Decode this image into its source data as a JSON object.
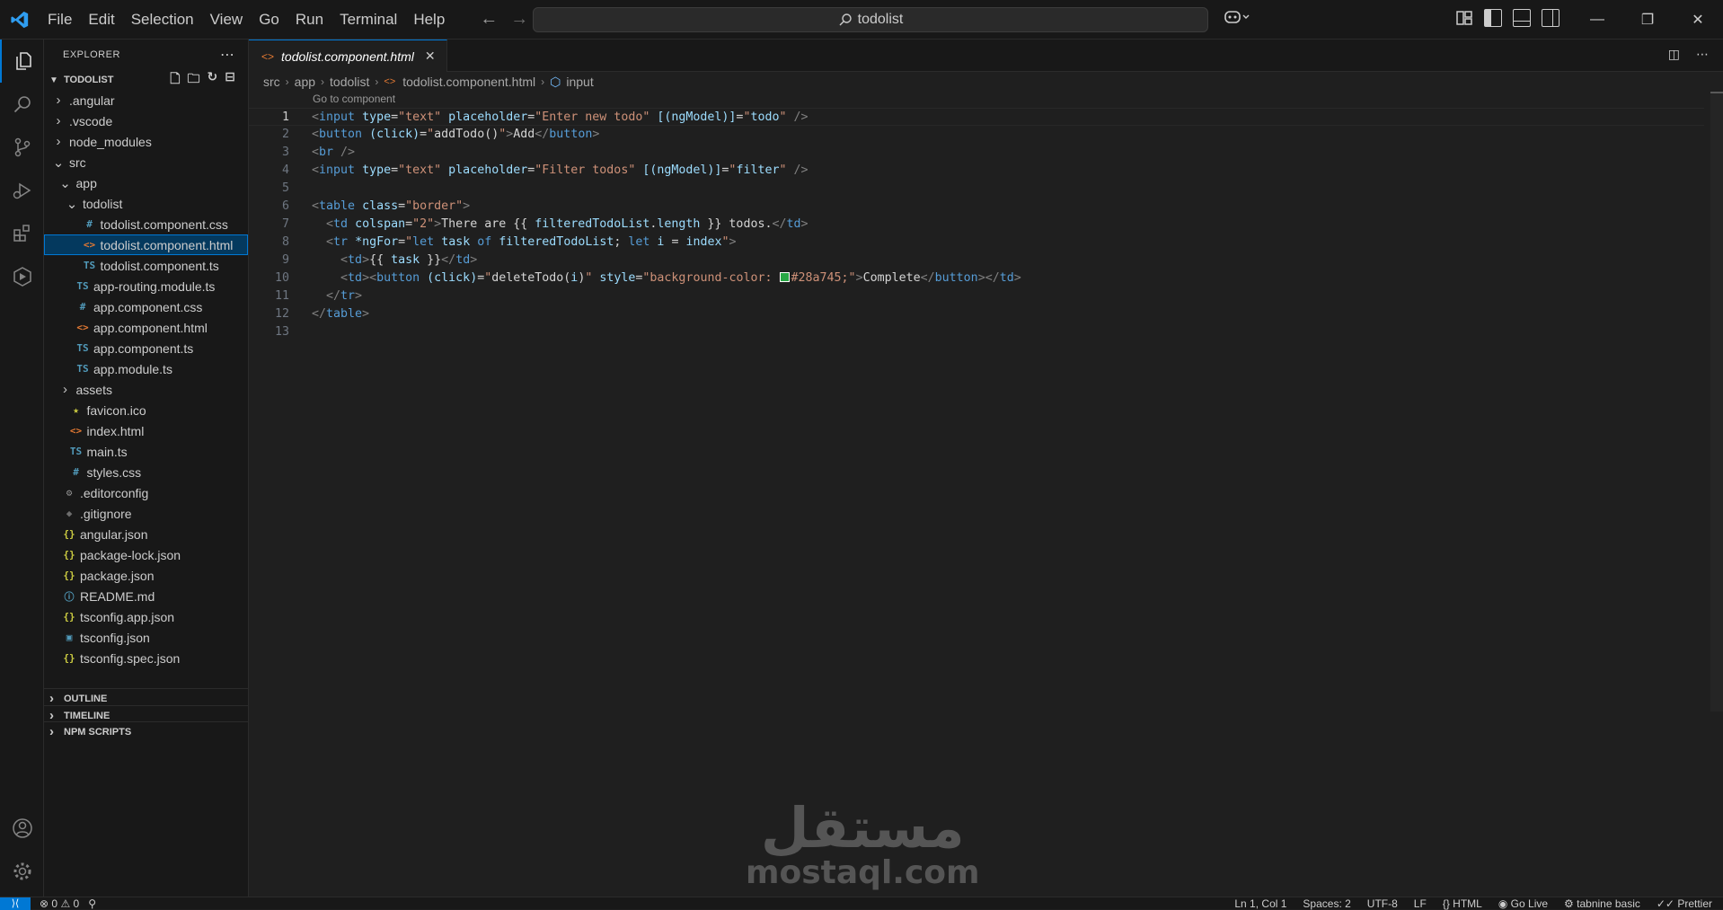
{
  "app": {
    "menu": [
      "File",
      "Edit",
      "Selection",
      "View",
      "Go",
      "Run",
      "Terminal",
      "Help"
    ],
    "search_text": "todolist"
  },
  "explorer": {
    "title": "EXPLORER",
    "root": "TODOLIST",
    "tree": [
      {
        "label": ".angular",
        "depth": 1,
        "kind": "folder",
        "expanded": false
      },
      {
        "label": ".vscode",
        "depth": 1,
        "kind": "folder",
        "expanded": false
      },
      {
        "label": "node_modules",
        "depth": 1,
        "kind": "folder",
        "expanded": false
      },
      {
        "label": "src",
        "depth": 1,
        "kind": "folder",
        "expanded": true
      },
      {
        "label": "app",
        "depth": 2,
        "kind": "folder",
        "expanded": true
      },
      {
        "label": "todolist",
        "depth": 3,
        "kind": "folder",
        "expanded": true
      },
      {
        "label": "todolist.component.css",
        "depth": 4,
        "kind": "css"
      },
      {
        "label": "todolist.component.html",
        "depth": 4,
        "kind": "html",
        "selected": true
      },
      {
        "label": "todolist.component.ts",
        "depth": 4,
        "kind": "ts"
      },
      {
        "label": "app-routing.module.ts",
        "depth": 3,
        "kind": "ts"
      },
      {
        "label": "app.component.css",
        "depth": 3,
        "kind": "css"
      },
      {
        "label": "app.component.html",
        "depth": 3,
        "kind": "html"
      },
      {
        "label": "app.component.ts",
        "depth": 3,
        "kind": "ts"
      },
      {
        "label": "app.module.ts",
        "depth": 3,
        "kind": "ts"
      },
      {
        "label": "assets",
        "depth": 2,
        "kind": "folder",
        "expanded": false
      },
      {
        "label": "favicon.ico",
        "depth": 2,
        "kind": "ico"
      },
      {
        "label": "index.html",
        "depth": 2,
        "kind": "html"
      },
      {
        "label": "main.ts",
        "depth": 2,
        "kind": "ts"
      },
      {
        "label": "styles.css",
        "depth": 2,
        "kind": "css"
      },
      {
        "label": ".editorconfig",
        "depth": 1,
        "kind": "config"
      },
      {
        "label": ".gitignore",
        "depth": 1,
        "kind": "git"
      },
      {
        "label": "angular.json",
        "depth": 1,
        "kind": "json"
      },
      {
        "label": "package-lock.json",
        "depth": 1,
        "kind": "json"
      },
      {
        "label": "package.json",
        "depth": 1,
        "kind": "json"
      },
      {
        "label": "README.md",
        "depth": 1,
        "kind": "md"
      },
      {
        "label": "tsconfig.app.json",
        "depth": 1,
        "kind": "json"
      },
      {
        "label": "tsconfig.json",
        "depth": 1,
        "kind": "tsconfig"
      },
      {
        "label": "tsconfig.spec.json",
        "depth": 1,
        "kind": "json"
      }
    ],
    "sections": [
      "OUTLINE",
      "TIMELINE",
      "NPM SCRIPTS"
    ]
  },
  "editor": {
    "tab_label": "todolist.component.html",
    "breadcrumb": [
      "src",
      "app",
      "todolist",
      "todolist.component.html",
      "input"
    ],
    "codelens": "Go to component",
    "lines": [
      [
        [
          "t-tag",
          "<"
        ],
        [
          "t-name",
          "input"
        ],
        [
          "t-txt",
          " "
        ],
        [
          "t-attr",
          "type"
        ],
        [
          "t-txt",
          "="
        ],
        [
          "t-str",
          "\"text\""
        ],
        [
          "t-txt",
          " "
        ],
        [
          "t-attr",
          "placeholder"
        ],
        [
          "t-txt",
          "="
        ],
        [
          "t-str",
          "\"Enter new todo\""
        ],
        [
          "t-txt",
          " "
        ],
        [
          "t-attr",
          "[(ngModel)]"
        ],
        [
          "t-txt",
          "="
        ],
        [
          "t-str",
          "\""
        ],
        [
          "t-var",
          "todo"
        ],
        [
          "t-str",
          "\""
        ],
        [
          "t-txt",
          " "
        ],
        [
          "t-tag",
          "/>"
        ]
      ],
      [
        [
          "t-tag",
          "<"
        ],
        [
          "t-name",
          "button"
        ],
        [
          "t-txt",
          " "
        ],
        [
          "t-attr",
          "(click)"
        ],
        [
          "t-txt",
          "="
        ],
        [
          "t-str",
          "\""
        ],
        [
          "t-txt",
          "addTodo()"
        ],
        [
          "t-str",
          "\""
        ],
        [
          "t-tag",
          ">"
        ],
        [
          "t-txt",
          "Add"
        ],
        [
          "t-tag",
          "</"
        ],
        [
          "t-name",
          "button"
        ],
        [
          "t-tag",
          ">"
        ]
      ],
      [
        [
          "t-tag",
          "<"
        ],
        [
          "t-name",
          "br"
        ],
        [
          "t-txt",
          " "
        ],
        [
          "t-tag",
          "/>"
        ]
      ],
      [
        [
          "t-tag",
          "<"
        ],
        [
          "t-name",
          "input"
        ],
        [
          "t-txt",
          " "
        ],
        [
          "t-attr",
          "type"
        ],
        [
          "t-txt",
          "="
        ],
        [
          "t-str",
          "\"text\""
        ],
        [
          "t-txt",
          " "
        ],
        [
          "t-attr",
          "placeholder"
        ],
        [
          "t-txt",
          "="
        ],
        [
          "t-str",
          "\"Filter todos\""
        ],
        [
          "t-txt",
          " "
        ],
        [
          "t-attr",
          "[(ngModel)]"
        ],
        [
          "t-txt",
          "="
        ],
        [
          "t-str",
          "\""
        ],
        [
          "t-var",
          "filter"
        ],
        [
          "t-str",
          "\""
        ],
        [
          "t-txt",
          " "
        ],
        [
          "t-tag",
          "/>"
        ]
      ],
      [],
      [
        [
          "t-tag",
          "<"
        ],
        [
          "t-name",
          "table"
        ],
        [
          "t-txt",
          " "
        ],
        [
          "t-attr",
          "class"
        ],
        [
          "t-txt",
          "="
        ],
        [
          "t-str",
          "\"border\""
        ],
        [
          "t-tag",
          ">"
        ]
      ],
      [
        [
          "t-txt",
          "  "
        ],
        [
          "t-tag",
          "<"
        ],
        [
          "t-name",
          "td"
        ],
        [
          "t-txt",
          " "
        ],
        [
          "t-attr",
          "colspan"
        ],
        [
          "t-txt",
          "="
        ],
        [
          "t-str",
          "\"2\""
        ],
        [
          "t-tag",
          ">"
        ],
        [
          "t-txt",
          "There are {{ "
        ],
        [
          "t-var",
          "filteredTodoList"
        ],
        [
          "t-txt",
          "."
        ],
        [
          "t-var",
          "length"
        ],
        [
          "t-txt",
          " }} todos."
        ],
        [
          "t-tag",
          "</"
        ],
        [
          "t-name",
          "td"
        ],
        [
          "t-tag",
          ">"
        ]
      ],
      [
        [
          "t-txt",
          "  "
        ],
        [
          "t-tag",
          "<"
        ],
        [
          "t-name",
          "tr"
        ],
        [
          "t-txt",
          " "
        ],
        [
          "t-attr",
          "*ngFor"
        ],
        [
          "t-txt",
          "="
        ],
        [
          "t-str",
          "\""
        ],
        [
          "t-kw",
          "let"
        ],
        [
          "t-txt",
          " "
        ],
        [
          "t-var",
          "task"
        ],
        [
          "t-txt",
          " "
        ],
        [
          "t-kw",
          "of"
        ],
        [
          "t-txt",
          " "
        ],
        [
          "t-var",
          "filteredTodoList"
        ],
        [
          "t-txt",
          "; "
        ],
        [
          "t-kw",
          "let"
        ],
        [
          "t-txt",
          " "
        ],
        [
          "t-var",
          "i"
        ],
        [
          "t-txt",
          " = "
        ],
        [
          "t-var",
          "index"
        ],
        [
          "t-str",
          "\""
        ],
        [
          "t-tag",
          ">"
        ]
      ],
      [
        [
          "t-txt",
          "    "
        ],
        [
          "t-tag",
          "<"
        ],
        [
          "t-name",
          "td"
        ],
        [
          "t-tag",
          ">"
        ],
        [
          "t-txt",
          "{{ "
        ],
        [
          "t-var",
          "task"
        ],
        [
          "t-txt",
          " }}"
        ],
        [
          "t-tag",
          "</"
        ],
        [
          "t-name",
          "td"
        ],
        [
          "t-tag",
          ">"
        ]
      ],
      [
        [
          "t-txt",
          "    "
        ],
        [
          "t-tag",
          "<"
        ],
        [
          "t-name",
          "td"
        ],
        [
          "t-tag",
          ">"
        ],
        [
          "t-tag",
          "<"
        ],
        [
          "t-name",
          "button"
        ],
        [
          "t-txt",
          " "
        ],
        [
          "t-attr",
          "(click)"
        ],
        [
          "t-txt",
          "="
        ],
        [
          "t-str",
          "\""
        ],
        [
          "t-txt",
          "deleteTodo("
        ],
        [
          "t-var",
          "i"
        ],
        [
          "t-txt",
          ")"
        ],
        [
          "t-str",
          "\""
        ],
        [
          "t-txt",
          " "
        ],
        [
          "t-attr",
          "style"
        ],
        [
          "t-txt",
          "="
        ],
        [
          "t-str",
          "\"background-color: "
        ],
        [
          "swatch",
          "#28a745"
        ],
        [
          "t-str",
          "#28a745;\""
        ],
        [
          "t-tag",
          ">"
        ],
        [
          "t-txt",
          "Complete"
        ],
        [
          "t-tag",
          "</"
        ],
        [
          "t-name",
          "button"
        ],
        [
          "t-tag",
          "></"
        ],
        [
          "t-name",
          "td"
        ],
        [
          "t-tag",
          ">"
        ]
      ],
      [
        [
          "t-txt",
          "  "
        ],
        [
          "t-tag",
          "</"
        ],
        [
          "t-name",
          "tr"
        ],
        [
          "t-tag",
          ">"
        ]
      ],
      [
        [
          "t-tag",
          "</"
        ],
        [
          "t-name",
          "table"
        ],
        [
          "t-tag",
          ">"
        ]
      ],
      []
    ]
  },
  "watermark": {
    "arabic": "مستقل",
    "latin": "mostaql.com"
  },
  "status": {
    "errors": "0",
    "warnings": "0",
    "position": "Ln 1, Col 1",
    "spaces": "Spaces: 2",
    "encoding": "UTF-8",
    "eol": "LF",
    "language": "HTML",
    "golive": "Go Live",
    "tabnine": "tabnine basic",
    "prettier": "Prettier"
  },
  "colors": {
    "accent": "#0078d4",
    "swatch": "#28a745"
  }
}
